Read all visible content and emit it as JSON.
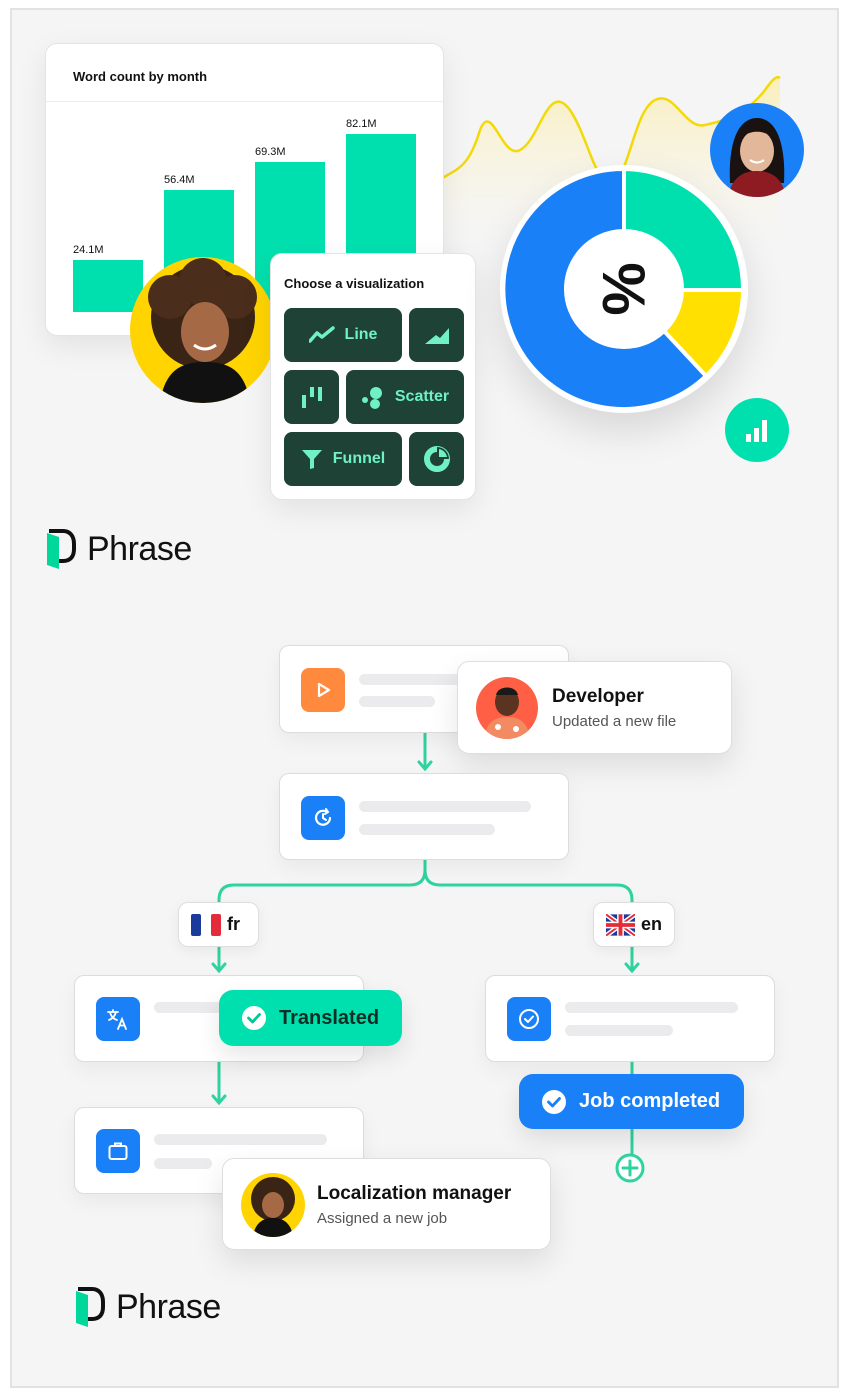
{
  "chart_data": {
    "type": "bar",
    "title": "Word count by month",
    "categories": [
      "",
      "",
      "",
      ""
    ],
    "values": [
      24.1,
      56.4,
      69.3,
      82.1
    ],
    "value_labels": [
      "24.1M",
      "56.4M",
      "69.3M",
      "82.1M"
    ],
    "color": "#00e0ae",
    "grid": false
  },
  "viz_picker": {
    "title": "Choose a visualization",
    "options": [
      {
        "label": "Line",
        "icon": "line-chart-icon"
      },
      {
        "label": "",
        "icon": "area-chart-icon"
      },
      {
        "label": "",
        "icon": "bar-chart-icon"
      },
      {
        "label": "Scatter",
        "icon": "scatter-icon"
      },
      {
        "label": "Funnel",
        "icon": "funnel-icon"
      },
      {
        "label": "",
        "icon": "pie-chart-icon"
      }
    ]
  },
  "donut": {
    "center_symbol": "%",
    "colors": {
      "blue": "#1a80f7",
      "green": "#00e0ae",
      "yellow": "#ffe000"
    }
  },
  "logo": {
    "text": "Phrase",
    "color": "#00d89b"
  },
  "workflow": {
    "developer": {
      "title": "Developer",
      "subtitle": "Updated a new file"
    },
    "languages": [
      {
        "code": "fr",
        "flag": "france-flag-icon"
      },
      {
        "code": "en",
        "flag": "uk-flag-icon"
      }
    ],
    "translated": {
      "label": "Translated"
    },
    "job_completed": {
      "label": "Job completed"
    },
    "manager": {
      "title": "Localization manager",
      "subtitle": "Assigned a new job"
    },
    "colors": {
      "accent": "#00e0ae",
      "blue": "#1a80f7",
      "orange": "#ff8a3d",
      "line": "#2ed3a0"
    }
  }
}
